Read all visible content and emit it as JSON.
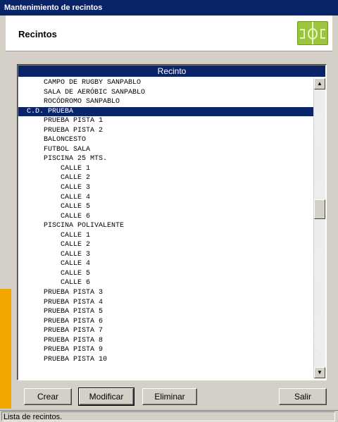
{
  "window": {
    "title": "Mantenimiento de recintos"
  },
  "header": {
    "title": "Recintos",
    "icon": "sports-field-icon"
  },
  "list": {
    "column_header": "Recinto",
    "rows": [
      "      CAMPO DE RUGBY SANPABLO",
      "      SALA DE AERÓBIC SANPABLO",
      "      ROCÓDROMO SANPABLO",
      "  C.D. PRUEBA",
      "      PRUEBA PISTA 1",
      "      PRUEBA PISTA 2",
      "      BALONCESTO",
      "      FUTBOL SALA",
      "      PISCINA 25 MTS.",
      "          CALLE 1",
      "          CALLE 2",
      "          CALLE 3",
      "          CALLE 4",
      "          CALLE 5",
      "          CALLE 6",
      "      PISCINA POLIVALENTE",
      "          CALLE 1",
      "          CALLE 2",
      "          CALLE 3",
      "          CALLE 4",
      "          CALLE 5",
      "          CALLE 6",
      "      PRUEBA PISTA 3",
      "      PRUEBA PISTA 4",
      "      PRUEBA PISTA 5",
      "      PRUEBA PISTA 6",
      "      PRUEBA PISTA 7",
      "      PRUEBA PISTA 8",
      "      PRUEBA PISTA 9",
      "      PRUEBA PISTA 10"
    ],
    "selected_index": 3
  },
  "buttons": {
    "crear": "Crear",
    "modificar": "Modificar",
    "eliminar": "Eliminar",
    "salir": "Salir"
  },
  "status": {
    "text": "Lista de recintos."
  }
}
